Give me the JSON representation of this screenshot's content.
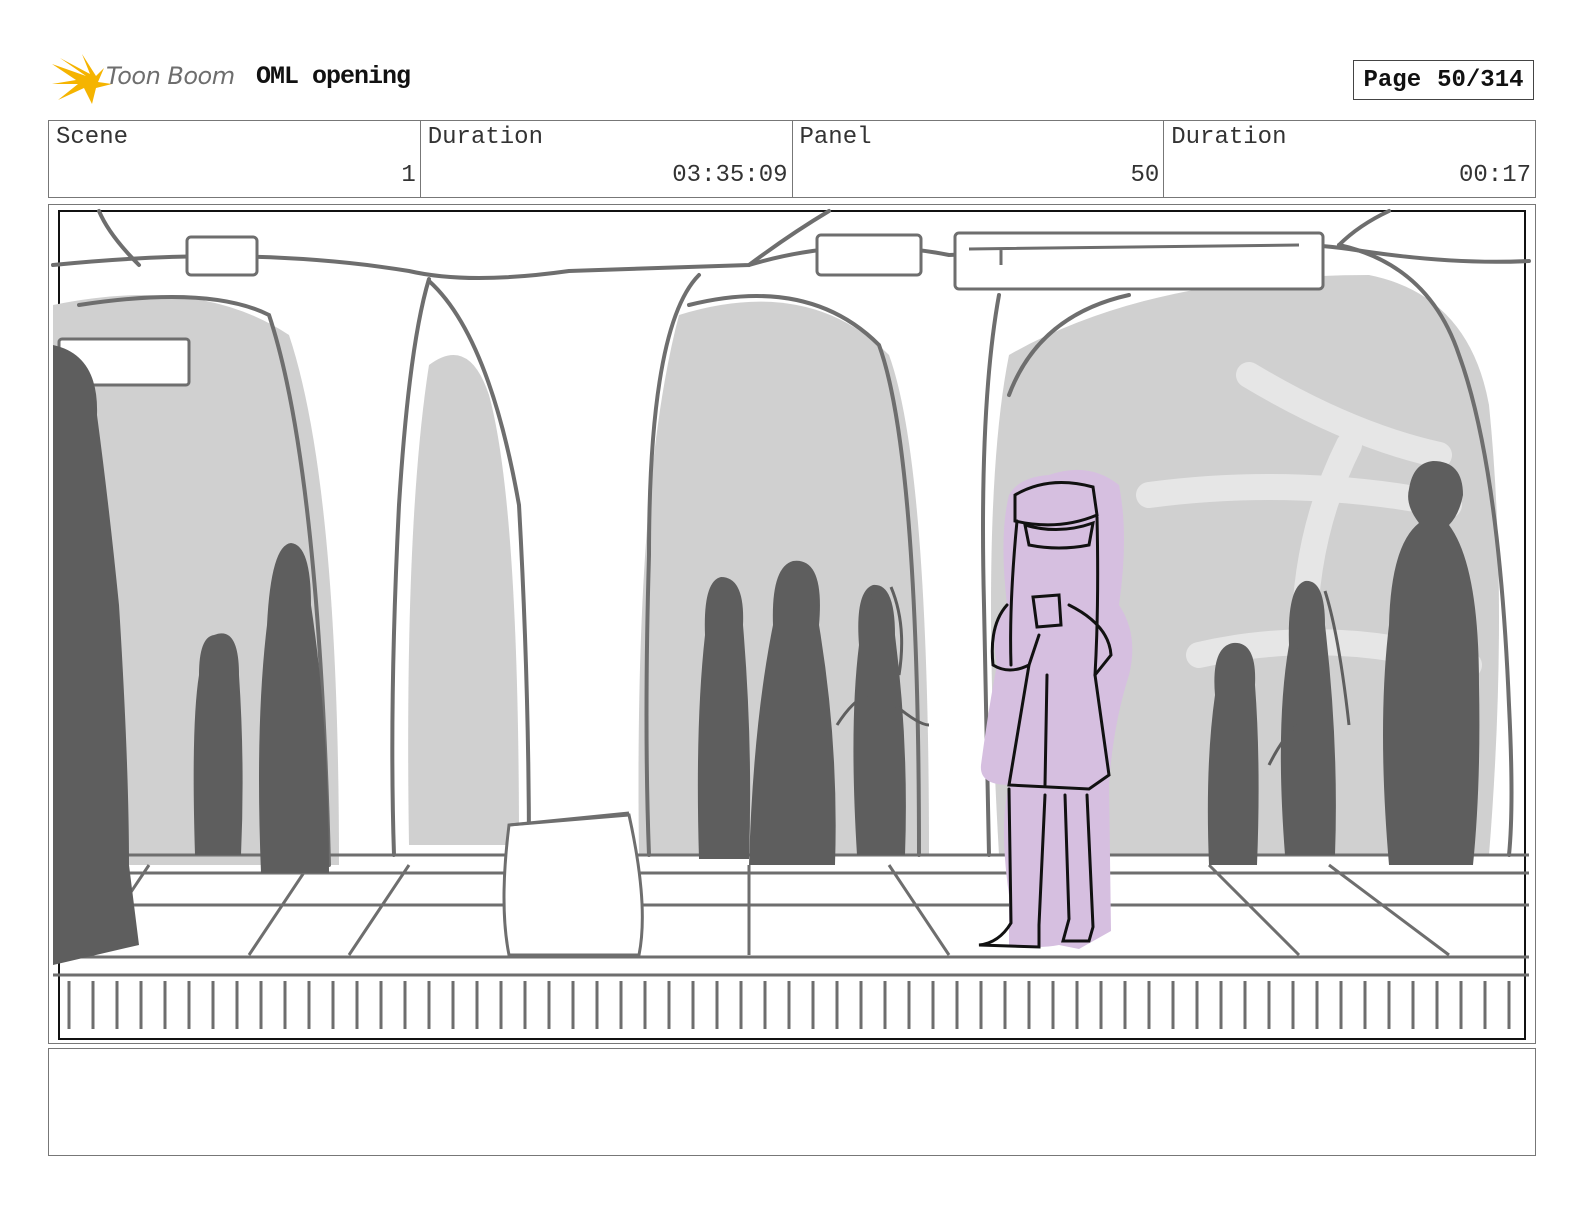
{
  "header": {
    "logo_text": "Toon Boom",
    "project_title": "OML opening",
    "page_label": "Page",
    "page_number": "50/314"
  },
  "info": [
    {
      "label": "Scene",
      "value": "1"
    },
    {
      "label": "Duration",
      "value": "03:35:09"
    },
    {
      "label": "Panel",
      "value": "50"
    },
    {
      "label": "Duration",
      "value": "00:17"
    }
  ],
  "colors": {
    "sketch_line": "#6e6e6e",
    "arch_fill": "#d0d0d0",
    "silhouette": "#5e5e5e",
    "character_fill": "#d6bfe0",
    "logo_accent": "#f5b400"
  },
  "notes": ""
}
